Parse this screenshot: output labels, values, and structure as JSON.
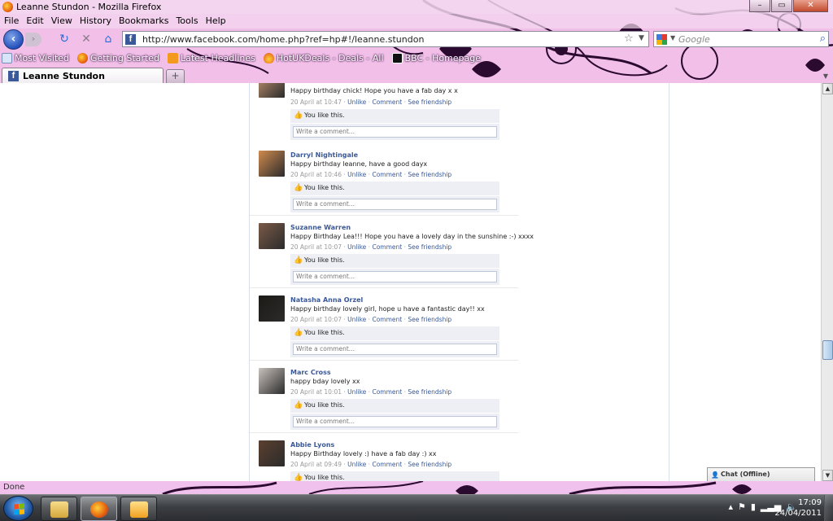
{
  "window": {
    "title": "Leanne Stundon - Mozilla Firefox",
    "controls": {
      "minimize": "–",
      "maximize": "▭",
      "close": "✕"
    }
  },
  "menu": [
    "File",
    "Edit",
    "View",
    "History",
    "Bookmarks",
    "Tools",
    "Help"
  ],
  "nav": {
    "url": "http://www.facebook.com/home.php?ref=hp#!/leanne.stundon",
    "search_placeholder": "Google"
  },
  "bookmarks": [
    {
      "label": "Most Visited",
      "icon": "page-icon"
    },
    {
      "label": "Getting Started",
      "icon": "firefox-icon"
    },
    {
      "label": "Latest Headlines",
      "icon": "rss-icon"
    },
    {
      "label": "HotUKDeals - Deals - All",
      "icon": "flame-icon"
    },
    {
      "label": "BBC - Homepage",
      "icon": "bbc-icon"
    }
  ],
  "tab": {
    "label": "Leanne Stundon",
    "new_tab": "+"
  },
  "stories": [
    {
      "name": "",
      "message": "Happy birthday chick! Hope you have a fab day x x",
      "time": "20 April at 10:47",
      "avatar_color": "#b48a6a"
    },
    {
      "name": "Darryl Nightingale",
      "message": "Happy birthday leanne, have a good dayx",
      "time": "20 April at 10:46",
      "avatar_color": "#d08a4e"
    },
    {
      "name": "Suzanne Warren",
      "message": "Happy Birthday Lea!!! Hope you have a lovely day in the sunshine :-) xxxx",
      "time": "20 April at 10:07",
      "avatar_color": "#7a5a48"
    },
    {
      "name": "Natasha Anna Orzel",
      "message": "Happy birthday lovely girl, hope u have a fantastic day!! xx",
      "time": "20 April at 10:07",
      "avatar_color": "#1c1a16"
    },
    {
      "name": "Marc Cross",
      "message": "happy bday lovely xx",
      "time": "20 April at 10:01",
      "avatar_color": "#c9c2bd"
    },
    {
      "name": "Abbie Lyons",
      "message": "Happy Birthday lovely :) have a fab day :) xx",
      "time": "20 April at 09:49",
      "avatar_color": "#5b4030"
    }
  ],
  "story_actions": {
    "unlike": "Unlike",
    "comment": "Comment",
    "see_friendship": "See friendship",
    "separator": "·",
    "you_like": "You like this.",
    "comment_placeholder": "Write a comment..."
  },
  "chat": {
    "label": "Chat (Offline)"
  },
  "status": {
    "text": "Done"
  },
  "clock": {
    "time": "17:09",
    "date": "24/04/2011"
  },
  "colors": {
    "facebook_blue": "#3b5998",
    "chrome_pink": "#f4c6ee",
    "chrome_purple": "#2a0a2e"
  }
}
